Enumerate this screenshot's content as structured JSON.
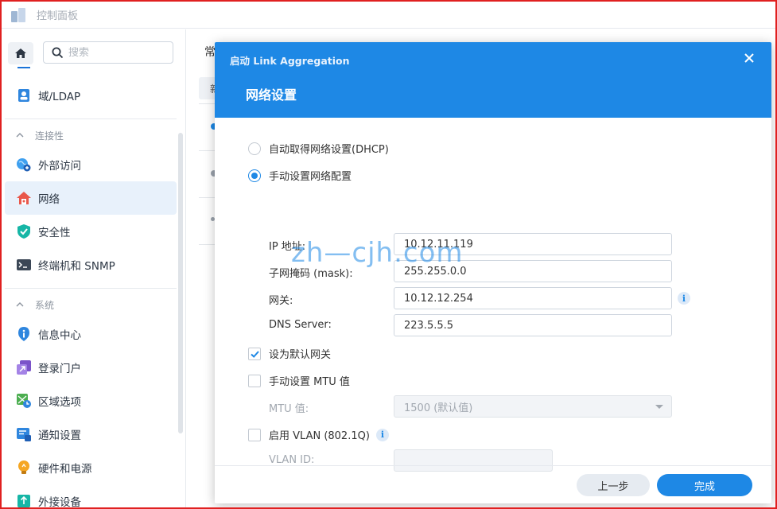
{
  "window": {
    "title": "控制面板"
  },
  "sidebar": {
    "search_placeholder": "搜索",
    "items": [
      {
        "label": "域/LDAP",
        "icon": "user-directory-icon"
      },
      {
        "label": "外部访问",
        "icon": "globe-link-icon"
      },
      {
        "label": "网络",
        "icon": "network-house-icon",
        "active": true
      },
      {
        "label": "安全性",
        "icon": "shield-check-icon"
      },
      {
        "label": "终端机和 SNMP",
        "icon": "terminal-icon"
      },
      {
        "label": "信息中心",
        "icon": "info-center-icon"
      },
      {
        "label": "登录门户",
        "icon": "login-portal-icon"
      },
      {
        "label": "区域选项",
        "icon": "regional-options-icon"
      },
      {
        "label": "通知设置",
        "icon": "notification-icon"
      },
      {
        "label": "硬件和电源",
        "icon": "lightbulb-icon"
      },
      {
        "label": "外接设备",
        "icon": "external-device-icon"
      }
    ],
    "sections": {
      "connectivity": "连接性",
      "system": "系统"
    }
  },
  "background": {
    "tab_label": "常",
    "button_label": "新"
  },
  "dialog": {
    "title": "启动 Link Aggregation",
    "subtitle": "网络设置",
    "dhcp_label": "自动取得网络设置(DHCP)",
    "manual_label": "手动设置网络配置",
    "ip_label": "IP 地址:",
    "ip_value": "10.12.11.119",
    "mask_label": "子网掩码 (mask):",
    "mask_value": "255.255.0.0",
    "gateway_label": "网关:",
    "gateway_value": "10.12.12.254",
    "dns_label": "DNS Server:",
    "dns_value": "223.5.5.5",
    "default_gateway_label": "设为默认网关",
    "mtu_manual_label": "手动设置 MTU 值",
    "mtu_label": "MTU 值:",
    "mtu_value": "1500 (默认值)",
    "vlan_label": "启用 VLAN (802.1Q)",
    "vlan_id_label": "VLAN ID:",
    "vlan_id_value": "",
    "info_glyph": "i",
    "prev_button": "上一步",
    "done_button": "完成"
  },
  "watermark": "zh—cjh.com",
  "colors": {
    "accent": "#1e88e5",
    "frame": "#e02020",
    "active_item_bg": "#e8f1fb"
  }
}
